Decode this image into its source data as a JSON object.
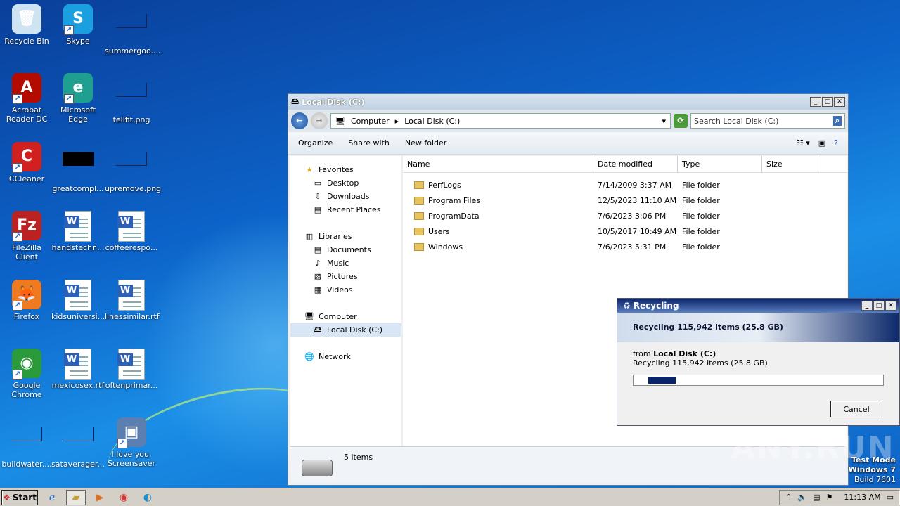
{
  "desktop": {
    "icons": [
      {
        "label": "Recycle Bin",
        "icon": "recycle-bin-icon"
      },
      {
        "label": "Skype",
        "icon": "skype-icon"
      },
      {
        "label": "summergoo....",
        "icon": "blank-file-icon"
      },
      {
        "label": "Acrobat Reader DC",
        "icon": "acrobat-icon"
      },
      {
        "label": "Microsoft Edge",
        "icon": "edge-icon"
      },
      {
        "label": "tellfit.png",
        "icon": "blank-file-icon"
      },
      {
        "label": "CCleaner",
        "icon": "ccleaner-icon"
      },
      {
        "label": "greatcompl...",
        "icon": "black-file-icon"
      },
      {
        "label": "upremove.png",
        "icon": "blank-file-icon"
      },
      {
        "label": "FileZilla Client",
        "icon": "filezilla-icon"
      },
      {
        "label": "handstechn...",
        "icon": "word-doc-icon"
      },
      {
        "label": "coffeerespo...",
        "icon": "word-doc-icon"
      },
      {
        "label": "Firefox",
        "icon": "firefox-icon"
      },
      {
        "label": "kidsuniversi...",
        "icon": "word-doc-icon"
      },
      {
        "label": "linessimilar.rtf",
        "icon": "word-doc-icon"
      },
      {
        "label": "Google Chrome",
        "icon": "chrome-icon"
      },
      {
        "label": "mexicosex.rtf",
        "icon": "word-doc-icon"
      },
      {
        "label": "oftenprimar...",
        "icon": "word-doc-icon"
      },
      {
        "label": "buildwater....",
        "icon": "blank-file-icon"
      },
      {
        "label": "sataverager...",
        "icon": "blank-file-icon"
      },
      {
        "label": "I love you. Screensaver",
        "icon": "screensaver-icon"
      }
    ]
  },
  "explorer": {
    "title": "Local Disk (C:)",
    "breadcrumb": [
      "Computer",
      "Local Disk (C:)"
    ],
    "search_placeholder": "Search Local Disk (C:)",
    "toolbar": {
      "organize": "Organize",
      "share": "Share with",
      "new_folder": "New folder"
    },
    "nav": {
      "favorites": "Favorites",
      "desktop": "Desktop",
      "downloads": "Downloads",
      "recent": "Recent Places",
      "libraries": "Libraries",
      "documents": "Documents",
      "music": "Music",
      "pictures": "Pictures",
      "videos": "Videos",
      "computer": "Computer",
      "local_disk": "Local Disk (C:)",
      "network": "Network"
    },
    "columns": [
      "Name",
      "Date modified",
      "Type",
      "Size"
    ],
    "rows": [
      {
        "name": "PerfLogs",
        "date": "7/14/2009 3:37 AM",
        "type": "File folder"
      },
      {
        "name": "Program Files",
        "date": "12/5/2023 11:10 AM",
        "type": "File folder"
      },
      {
        "name": "ProgramData",
        "date": "7/6/2023 3:06 PM",
        "type": "File folder"
      },
      {
        "name": "Users",
        "date": "10/5/2017 10:49 AM",
        "type": "File folder"
      },
      {
        "name": "Windows",
        "date": "7/6/2023 5:31 PM",
        "type": "File folder"
      }
    ],
    "status": "5 items"
  },
  "dialog": {
    "title": "Recycling",
    "header": "Recycling 115,942 items (25.8 GB)",
    "from_label": "from",
    "from_value": "Local Disk (C:)",
    "detail": "Recycling 115,942 items (25.8 GB)",
    "progress_fraction": 0.11,
    "cancel": "Cancel"
  },
  "taskbar": {
    "start": "Start",
    "clock": "11:13 AM"
  },
  "watermark": {
    "line1": "Test Mode",
    "line2": "Windows 7",
    "line3": "Build 7601",
    "brand": "ANY.RUN"
  }
}
